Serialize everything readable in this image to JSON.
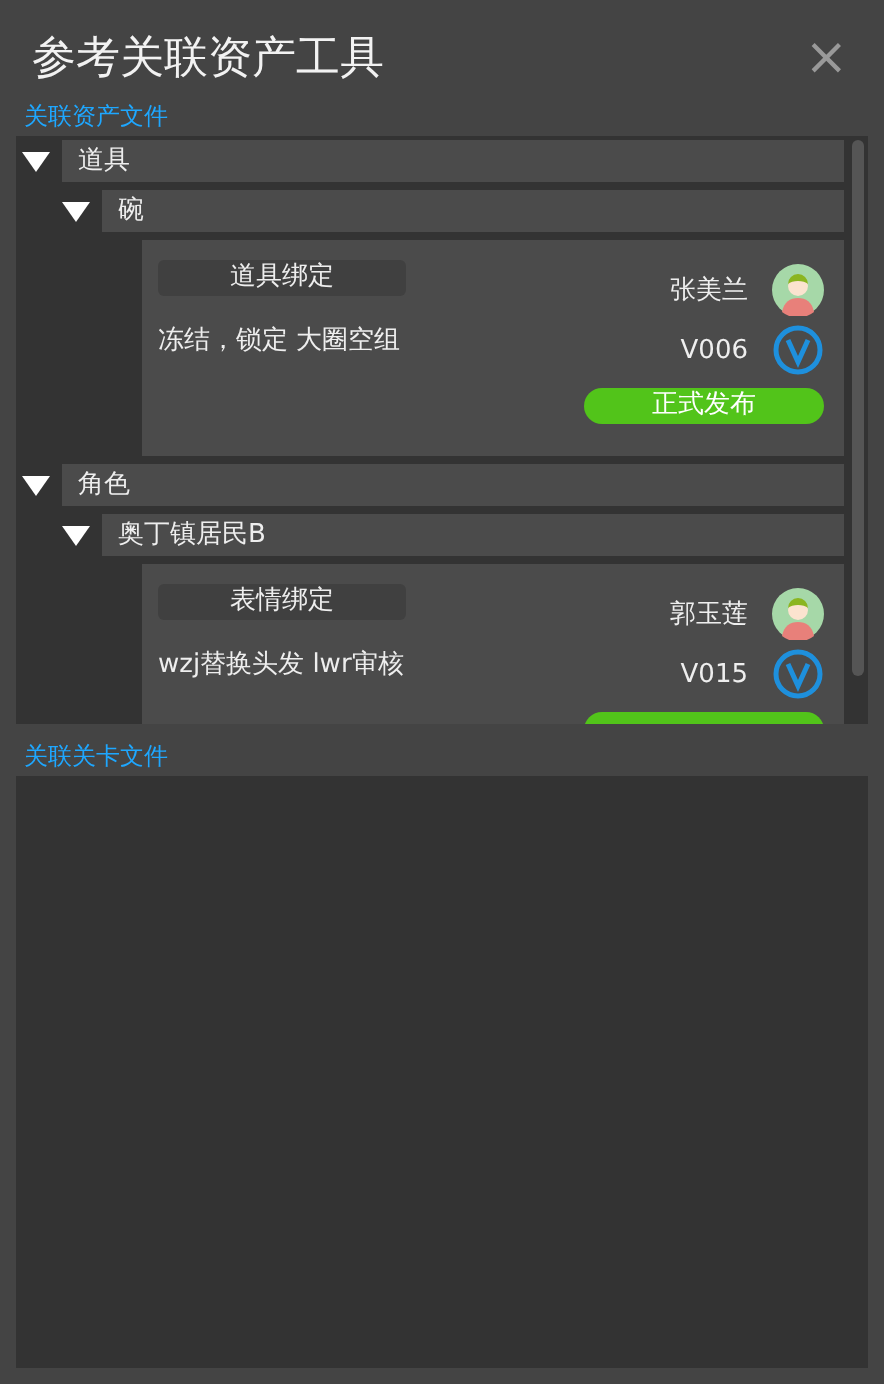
{
  "window": {
    "title": "参考关联资产工具",
    "close": "×"
  },
  "asset_section": {
    "label": "关联资产文件",
    "tree": [
      {
        "label": "道具",
        "expanded": true,
        "children": [
          {
            "label": "碗",
            "expanded": true,
            "cards": [
              {
                "tag": "道具绑定",
                "note": "冻结，锁定 大圈空组",
                "user": "张美兰",
                "version": "V006",
                "status": {
                  "kind": "published",
                  "label": "正式发布"
                }
              }
            ]
          }
        ]
      },
      {
        "label": "角色",
        "expanded": true,
        "children": [
          {
            "label": "奥丁镇居民B",
            "expanded": true,
            "cards": [
              {
                "tag": "表情绑定",
                "note": "wzj替换头发  lwr审核",
                "user": "郭玉莲",
                "version": "V015",
                "status": {
                  "kind": "published"
                }
              }
            ]
          }
        ]
      }
    ]
  },
  "level_section": {
    "label": "关联关卡文件"
  }
}
